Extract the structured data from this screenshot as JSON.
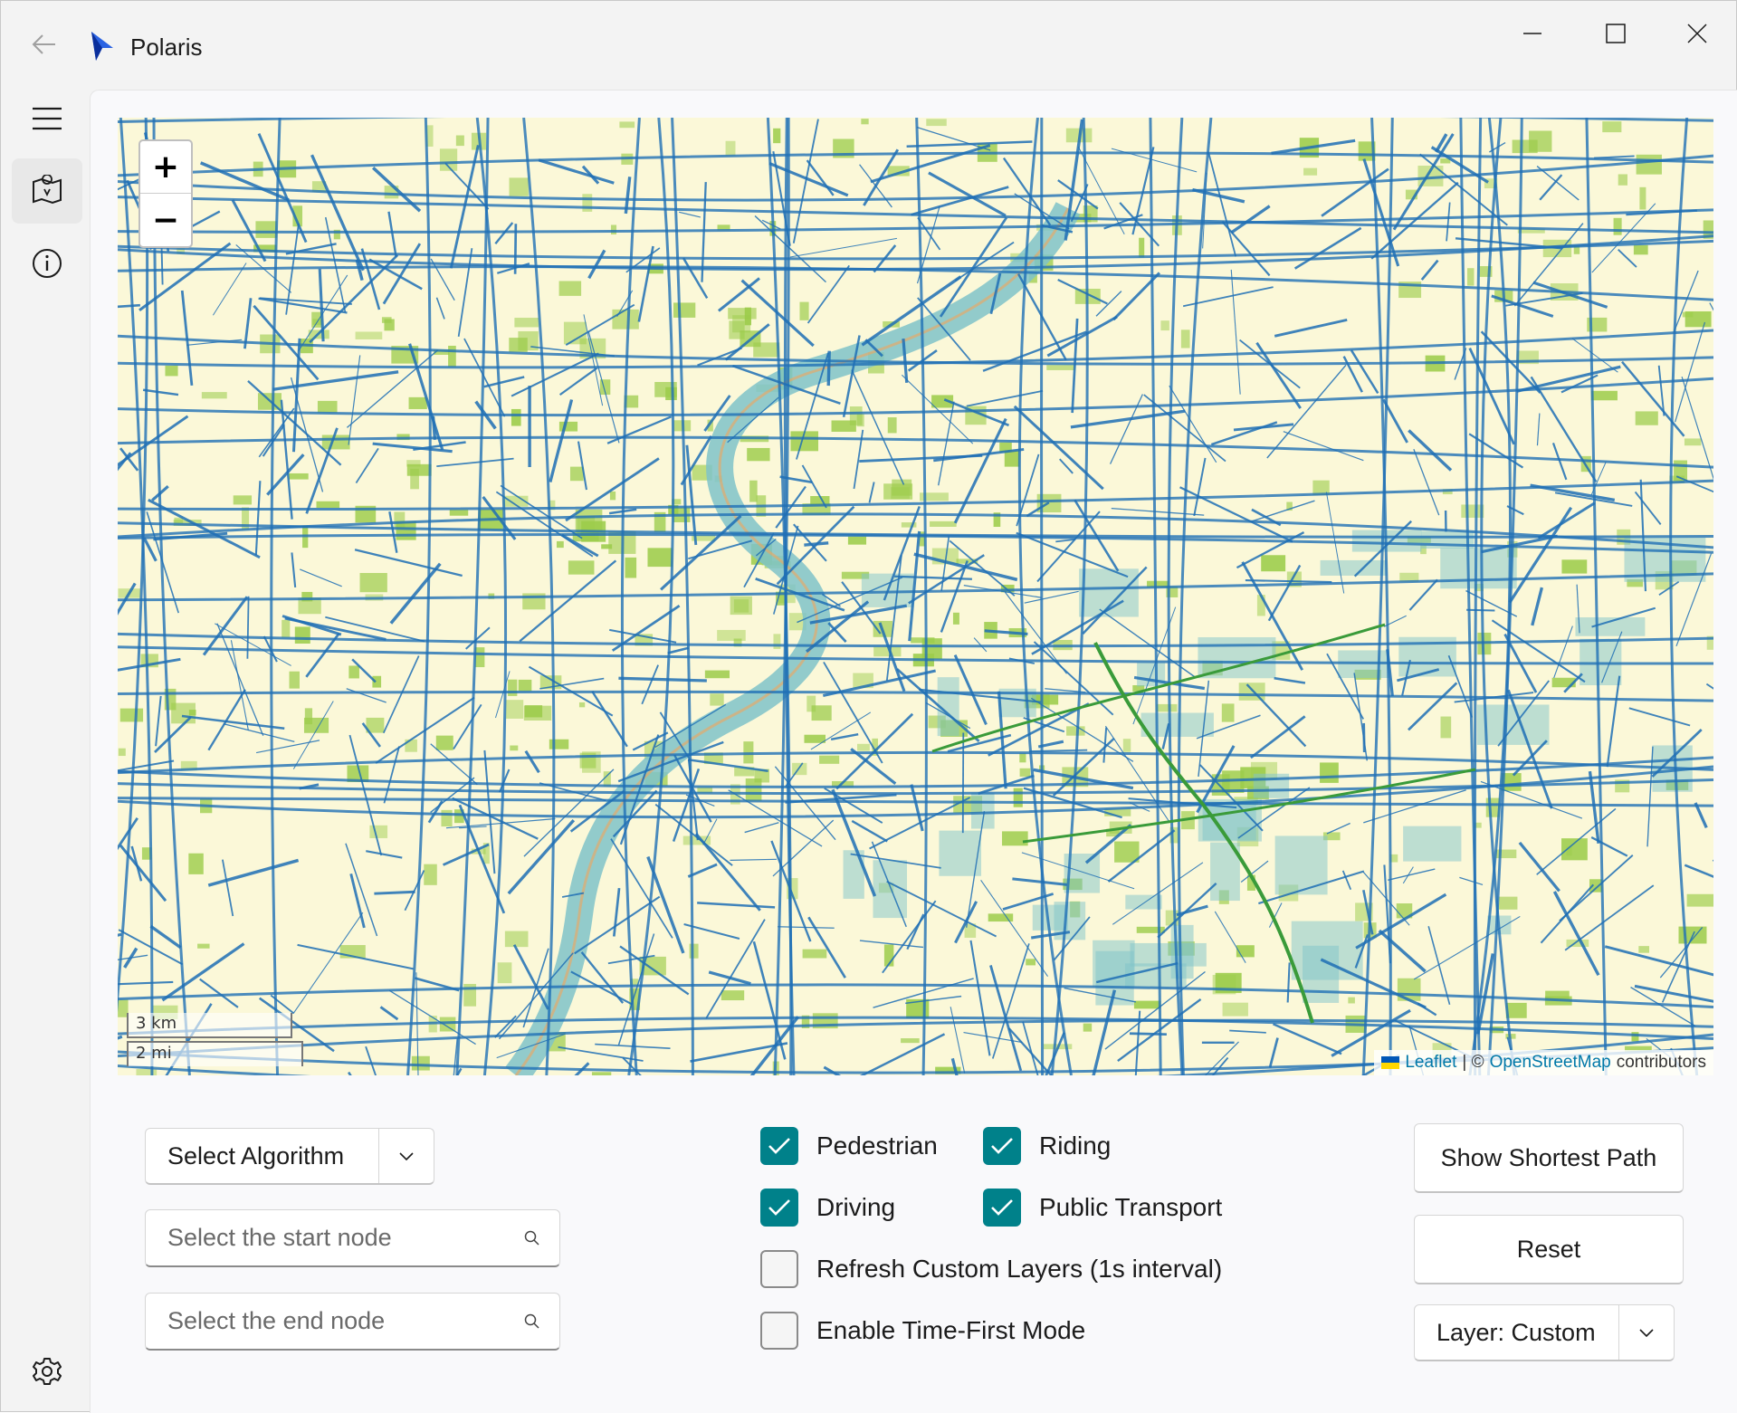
{
  "window": {
    "title": "Polaris",
    "icons": {
      "back": "back-arrow-icon",
      "app": "polaris-cursor-icon",
      "minimize": "minimize-icon",
      "maximize": "maximize-icon",
      "close": "close-icon"
    }
  },
  "nav": {
    "items": [
      {
        "icon": "hamburger-menu-icon"
      },
      {
        "icon": "map-icon",
        "selected": true
      },
      {
        "icon": "info-icon"
      },
      {
        "icon": "gear-icon"
      }
    ],
    "accent": "#00818a"
  },
  "map": {
    "zoom_in": "+",
    "zoom_out": "−",
    "scale_km": "3 km",
    "scale_mi": "2 mi",
    "attribution": {
      "leaflet": "Leaflet",
      "separator": "| ©",
      "osm": "OpenStreetMap",
      "suffix": "contributors"
    },
    "colors": {
      "land": "#fbf8d8",
      "roads": "#1f6fb5",
      "green": "#9ccc4b",
      "water": "#7fc3c9",
      "highway": "#f2a55c",
      "expressway": "#3a9b3a"
    }
  },
  "controls": {
    "algorithm": {
      "label": "Select Algorithm"
    },
    "start_node": {
      "placeholder": "Select the start node"
    },
    "end_node": {
      "placeholder": "Select the end node"
    },
    "checkboxes": {
      "pedestrian": {
        "label": "Pedestrian",
        "checked": true
      },
      "riding": {
        "label": "Riding",
        "checked": true
      },
      "driving": {
        "label": "Driving",
        "checked": true
      },
      "public_transport": {
        "label": "Public Transport",
        "checked": true
      },
      "refresh_layers": {
        "label": "Refresh Custom Layers (1s interval)",
        "checked": false
      },
      "time_first": {
        "label": "Enable Time-First Mode",
        "checked": false
      }
    },
    "show_shortest_path": "Show Shortest Path",
    "reset": "Reset",
    "layer": {
      "label": "Layer: Custom"
    }
  }
}
